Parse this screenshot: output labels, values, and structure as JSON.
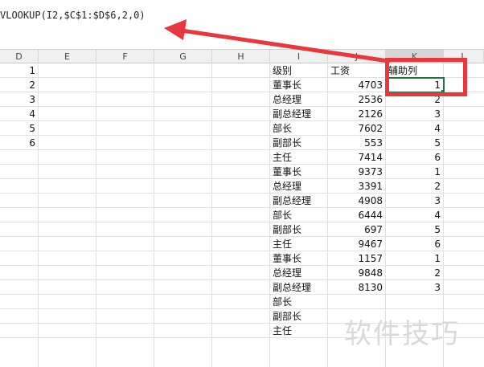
{
  "formula": "VLOOKUP(I2,$C$1:$D$6,2,0)",
  "columns": [
    "D",
    "E",
    "F",
    "G",
    "H",
    "I",
    "J",
    "K",
    "L"
  ],
  "col_d_values": [
    "1",
    "2",
    "3",
    "4",
    "5",
    "6"
  ],
  "headers": {
    "level": "级别",
    "salary": "工资",
    "helper": "辅助列"
  },
  "rows": [
    {
      "level": "董事长",
      "salary": "4703",
      "helper": "1"
    },
    {
      "level": "总经理",
      "salary": "2536",
      "helper": "2"
    },
    {
      "level": "副总经理",
      "salary": "2126",
      "helper": "3"
    },
    {
      "level": "部长",
      "salary": "7602",
      "helper": "4"
    },
    {
      "level": "副部长",
      "salary": "553",
      "helper": "5"
    },
    {
      "level": "主任",
      "salary": "7414",
      "helper": "6"
    },
    {
      "level": "董事长",
      "salary": "9373",
      "helper": "1"
    },
    {
      "level": "总经理",
      "salary": "3391",
      "helper": "2"
    },
    {
      "level": "副总经理",
      "salary": "4908",
      "helper": "3"
    },
    {
      "level": "部长",
      "salary": "6444",
      "helper": "4"
    },
    {
      "level": "副部长",
      "salary": "697",
      "helper": "5"
    },
    {
      "level": "主任",
      "salary": "9467",
      "helper": "6"
    },
    {
      "level": "董事长",
      "salary": "1157",
      "helper": "1"
    },
    {
      "level": "总经理",
      "salary": "9848",
      "helper": "2"
    },
    {
      "level": "副总经理",
      "salary": "8130",
      "helper": "3"
    },
    {
      "level": "部长",
      "salary": "",
      "helper": ""
    },
    {
      "level": "副部长",
      "salary": "",
      "helper": ""
    },
    {
      "level": "主任",
      "salary": "",
      "helper": ""
    }
  ],
  "watermark": "软件技巧",
  "colors": {
    "annotation": "#e8383d",
    "selection": "#217346"
  }
}
